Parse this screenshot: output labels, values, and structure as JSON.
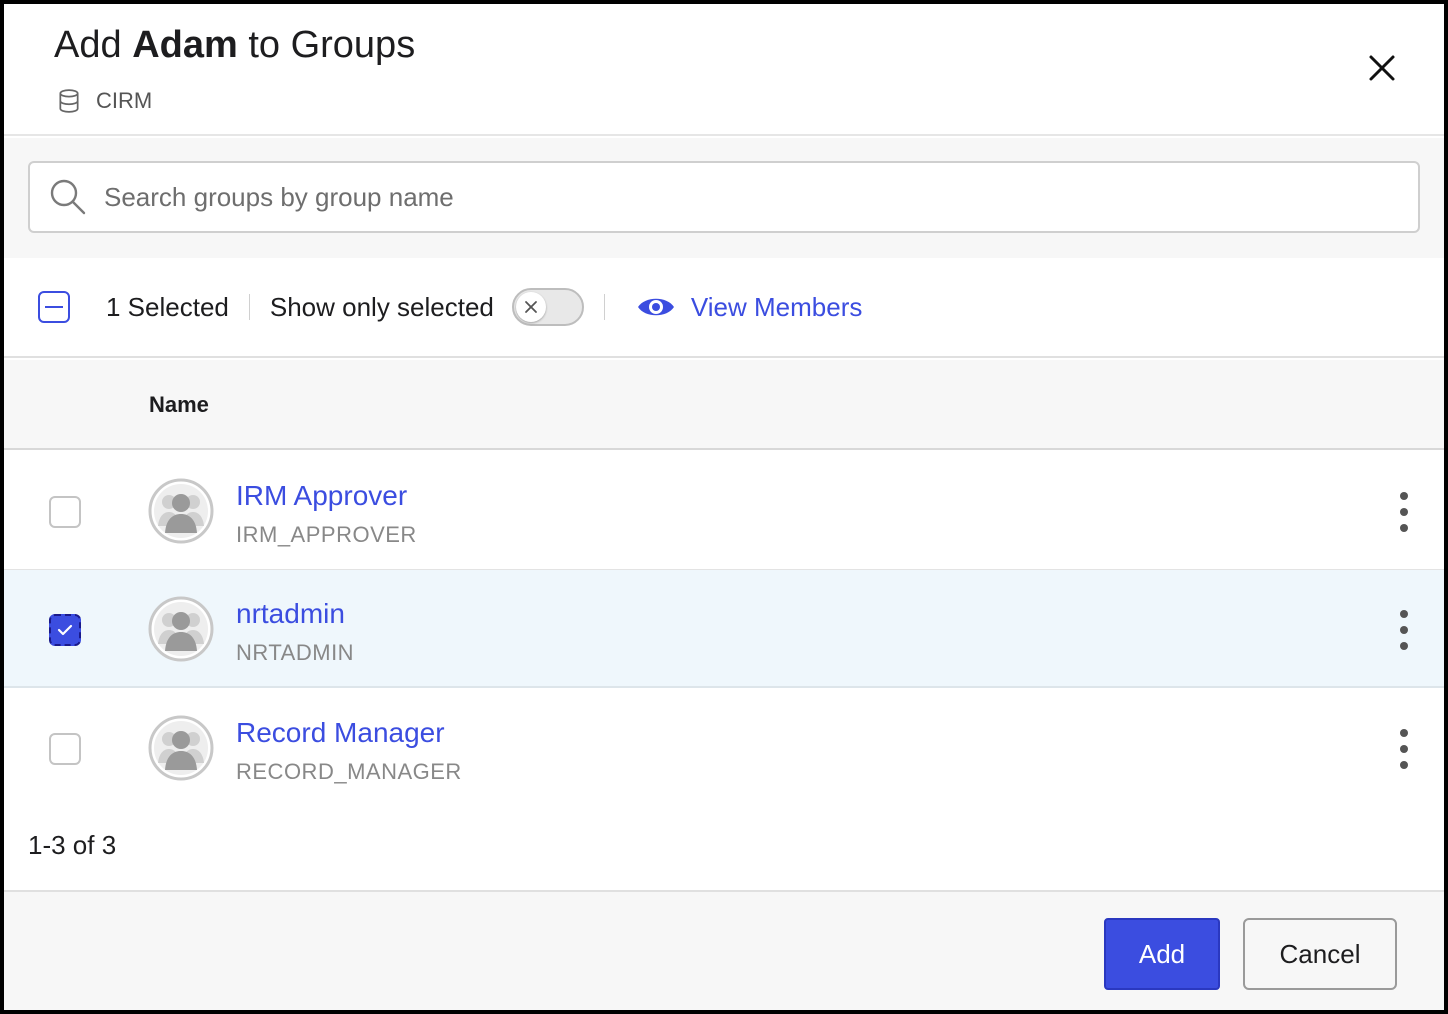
{
  "header": {
    "title_prefix": "Add",
    "title_user": "Adam",
    "title_suffix": "to Groups",
    "app_name": "CIRM",
    "app_icon": "database-icon",
    "close_icon": "close-icon"
  },
  "search": {
    "placeholder": "Search groups by group name",
    "value": "",
    "icon": "search-icon"
  },
  "toolbar": {
    "selected_count_label": "1 Selected",
    "show_only_selected_label": "Show only selected",
    "show_only_selected_on": false,
    "view_members_label": "View Members",
    "view_members_icon": "eye-icon"
  },
  "table": {
    "columns": [
      "Name"
    ],
    "rows": [
      {
        "name": "IRM Approver",
        "code": "IRM_APPROVER",
        "checked": false
      },
      {
        "name": "nrtadmin",
        "code": "NRTADMIN",
        "checked": true
      },
      {
        "name": "Record Manager",
        "code": "RECORD_MANAGER",
        "checked": false
      }
    ]
  },
  "pagination": {
    "label": "1-3 of 3"
  },
  "footer": {
    "add_label": "Add",
    "cancel_label": "Cancel"
  },
  "colors": {
    "accent": "#3b4de0",
    "selected_row_bg": "#eff7fc"
  }
}
